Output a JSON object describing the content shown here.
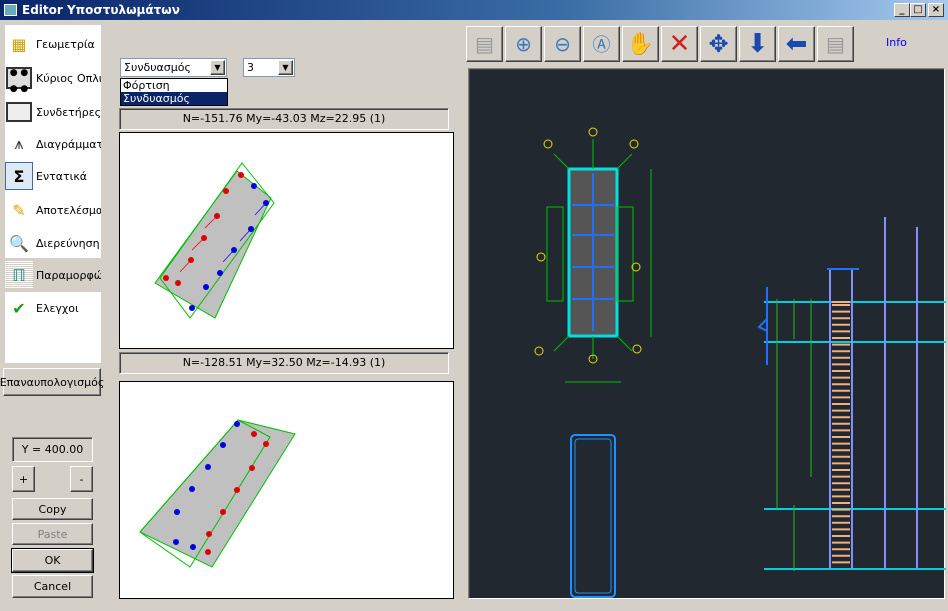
{
  "window": {
    "title": "Editor Υποστυλωμάτων",
    "minimize": "_",
    "maximize": "□",
    "close": "×"
  },
  "sidebar": {
    "items": [
      {
        "label": "Γεωμετρία",
        "icon": "geometry-icon"
      },
      {
        "label": "Κύριος Οπλισμός",
        "icon": "main-reinforcement-icon"
      },
      {
        "label": "Συνδετήρες",
        "icon": "stirrups-icon"
      },
      {
        "label": "Διαγράμματα",
        "icon": "diagrams-icon"
      },
      {
        "label": "Εντατικά",
        "icon": "sigma-icon"
      },
      {
        "label": "Αποτελέσματα",
        "icon": "results-icon"
      },
      {
        "label": "Διερεύνηση",
        "icon": "investigation-icon"
      },
      {
        "label": "Παραμορφώσεις",
        "icon": "deformation-icon",
        "selected": true
      },
      {
        "label": "Ελεγχοι",
        "icon": "checks-icon"
      }
    ]
  },
  "buttons": {
    "recalc": "Επαναυπολογισμός",
    "plus": "+",
    "minus": "-",
    "copy": "Copy",
    "paste": "Paste",
    "ok": "OK",
    "cancel": "Cancel"
  },
  "y_field": "Y = 400.00",
  "type_combo": {
    "value": "Συνδυασμός",
    "options": [
      "Φόρτιση",
      "Συνδυασμός"
    ],
    "highlighted": "Συνδυασμός"
  },
  "number_combo": {
    "value": "3"
  },
  "diagram1": {
    "label": "N=-151.76 My=-43.03 Mz=22.95 (1)"
  },
  "diagram2": {
    "label": "N=-128.51 My=32.50 Mz=-14.93 (1)"
  },
  "toolbar": {
    "items": [
      "properties-icon",
      "zoom-in-icon",
      "zoom-out-icon",
      "zoom-all-icon",
      "pan-hand-icon",
      "delete-x-icon",
      "move-arrows-icon",
      "arrow-down-icon",
      "arrow-left-icon",
      "properties-icon"
    ],
    "info": "Info"
  },
  "colors": {
    "titlebar": "#0a246a",
    "selection": "#0a246a",
    "cad_background": "#212830",
    "info_link": "#0000ff"
  }
}
